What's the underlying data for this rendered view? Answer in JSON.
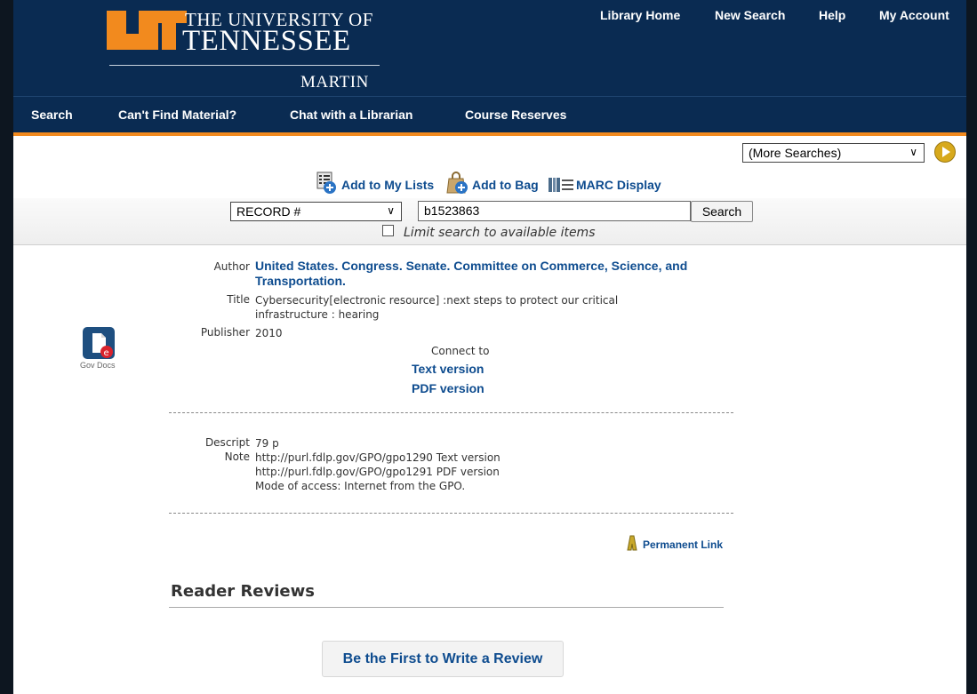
{
  "header": {
    "logo_line1": "THE UNIVERSITY OF",
    "logo_line2": "TENNESSEE",
    "logo_line3": "MARTIN",
    "links": [
      "Library Home",
      "New Search",
      "Help",
      "My Account"
    ],
    "brand_color": "#0a2b52",
    "accent_color": "#f28a1e"
  },
  "nav": {
    "items": [
      "Search",
      "Can't Find Material?",
      "Chat with a Librarian",
      "Course Reserves"
    ]
  },
  "more_searches": {
    "selected": "(More Searches)"
  },
  "actions": {
    "add_to_lists": "Add to My Lists",
    "add_to_bag": "Add to Bag",
    "marc_display": "MARC Display"
  },
  "search": {
    "field_selected": "RECORD #",
    "query": "b1523863",
    "button": "Search",
    "limit_label": "Limit search to available items",
    "limit_checked": false
  },
  "record": {
    "icon_caption": "Gov Docs",
    "author_label": "Author",
    "author_line1": "United States. Congress. Senate. Committee on Commerce, Science, and",
    "author_line2": "Transportation.",
    "title_label": "Title",
    "title_line1": "Cybersecurity[electronic resource] :next steps to protect our critical",
    "title_line2": "infrastructure : hearing",
    "publisher_label": "Publisher",
    "publisher": "2010",
    "connect_to": "Connect to",
    "text_version": "Text version",
    "pdf_version": "PDF version",
    "descript_label": "Descript",
    "descript": "79 p",
    "note_label": "Note",
    "note_line1": "http://purl.fdlp.gov/GPO/gpo1290 Text version",
    "note_line2": "http://purl.fdlp.gov/GPO/gpo1291 PDF version",
    "note_line3": "Mode of access: Internet from the GPO.",
    "permanent_link": "Permanent Link"
  },
  "reviews": {
    "title": "Reader Reviews",
    "button": "Be the First to Write a Review"
  }
}
